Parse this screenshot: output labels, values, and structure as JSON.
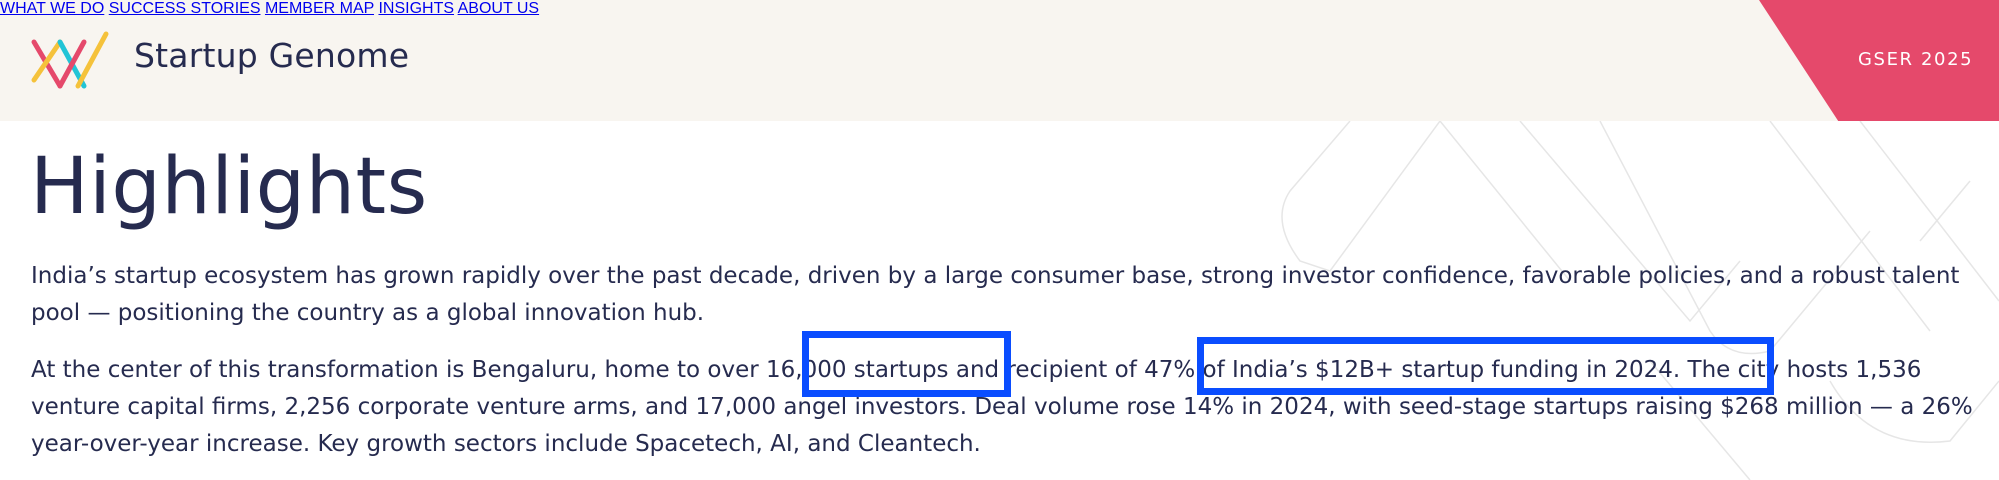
{
  "header": {
    "brand": "Startup Genome",
    "nav": [
      {
        "label": "WHAT WE DO"
      },
      {
        "label": "SUCCESS STORIES"
      },
      {
        "label": "MEMBER MAP"
      },
      {
        "label": "INSIGHTS"
      },
      {
        "label": "ABOUT US"
      }
    ],
    "cta": "GSER 2025"
  },
  "main": {
    "title": "Highlights",
    "paragraph1": "India’s startup ecosystem has grown rapidly over the past decade, driven by a large consumer base, strong investor confidence, favorable policies, and a robust talent pool — positioning the country as a global innovation hub.",
    "paragraph2": "At the center of this transformation is Bengaluru, home to over 16,000 startups and recipient of 47% of India’s $12B+ startup funding in 2024. The city hosts 1,536 venture capital firms, 2,256 corporate venture arms, and 17,000 angel investors. Deal volume rose 14% in 2024, with seed-stage startups raising $268 million — a 26% year-over-year increase. Key growth sectors include Spacetech, AI, and Cleantech."
  },
  "colors": {
    "accent": "#e5496b",
    "highlight_box": "#0a4dff",
    "text": "#262b4f",
    "header_bg": "#f8f5f0"
  }
}
